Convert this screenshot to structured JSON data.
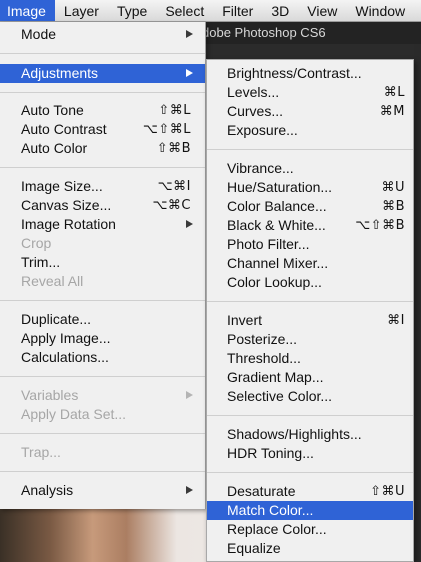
{
  "menubar": {
    "items": [
      "Image",
      "Layer",
      "Type",
      "Select",
      "Filter",
      "3D",
      "View",
      "Window"
    ]
  },
  "window_title": "dobe Photoshop CS6",
  "image_menu": {
    "items": [
      {
        "label": "Mode",
        "shortcut": "",
        "submenu": true
      },
      {
        "label": "Adjustments",
        "shortcut": "",
        "submenu": true,
        "highlighted": true
      },
      {
        "label": "Auto Tone",
        "shortcut": "⇧⌘L"
      },
      {
        "label": "Auto Contrast",
        "shortcut": "⌥⇧⌘L"
      },
      {
        "label": "Auto Color",
        "shortcut": "⇧⌘B"
      },
      {
        "label": "Image Size...",
        "shortcut": "⌥⌘I"
      },
      {
        "label": "Canvas Size...",
        "shortcut": "⌥⌘C"
      },
      {
        "label": "Image Rotation",
        "shortcut": "",
        "submenu": true
      },
      {
        "label": "Crop",
        "shortcut": "",
        "disabled": true
      },
      {
        "label": "Trim...",
        "shortcut": ""
      },
      {
        "label": "Reveal All",
        "shortcut": "",
        "disabled": true
      },
      {
        "label": "Duplicate...",
        "shortcut": ""
      },
      {
        "label": "Apply Image...",
        "shortcut": ""
      },
      {
        "label": "Calculations...",
        "shortcut": ""
      },
      {
        "label": "Variables",
        "shortcut": "",
        "submenu": true,
        "disabled": true
      },
      {
        "label": "Apply Data Set...",
        "shortcut": "",
        "disabled": true
      },
      {
        "label": "Trap...",
        "shortcut": "",
        "disabled": true
      },
      {
        "label": "Analysis",
        "shortcut": "",
        "submenu": true
      }
    ]
  },
  "adjustments_menu": {
    "items": [
      {
        "label": "Brightness/Contrast...",
        "shortcut": ""
      },
      {
        "label": "Levels...",
        "shortcut": "⌘L"
      },
      {
        "label": "Curves...",
        "shortcut": "⌘M"
      },
      {
        "label": "Exposure...",
        "shortcut": ""
      },
      {
        "label": "Vibrance...",
        "shortcut": ""
      },
      {
        "label": "Hue/Saturation...",
        "shortcut": "⌘U"
      },
      {
        "label": "Color Balance...",
        "shortcut": "⌘B"
      },
      {
        "label": "Black & White...",
        "shortcut": "⌥⇧⌘B"
      },
      {
        "label": "Photo Filter...",
        "shortcut": ""
      },
      {
        "label": "Channel Mixer...",
        "shortcut": ""
      },
      {
        "label": "Color Lookup...",
        "shortcut": ""
      },
      {
        "label": "Invert",
        "shortcut": "⌘I"
      },
      {
        "label": "Posterize...",
        "shortcut": ""
      },
      {
        "label": "Threshold...",
        "shortcut": ""
      },
      {
        "label": "Gradient Map...",
        "shortcut": ""
      },
      {
        "label": "Selective Color...",
        "shortcut": ""
      },
      {
        "label": "Shadows/Highlights...",
        "shortcut": ""
      },
      {
        "label": "HDR Toning...",
        "shortcut": ""
      },
      {
        "label": "Desaturate",
        "shortcut": "⇧⌘U"
      },
      {
        "label": "Match Color...",
        "shortcut": "",
        "highlighted": true
      },
      {
        "label": "Replace Color...",
        "shortcut": ""
      },
      {
        "label": "Equalize",
        "shortcut": ""
      }
    ]
  },
  "colors": {
    "highlight": "#2f63d6",
    "menu_bg": "#f0f0f0",
    "disabled": "#a6a6a6"
  }
}
